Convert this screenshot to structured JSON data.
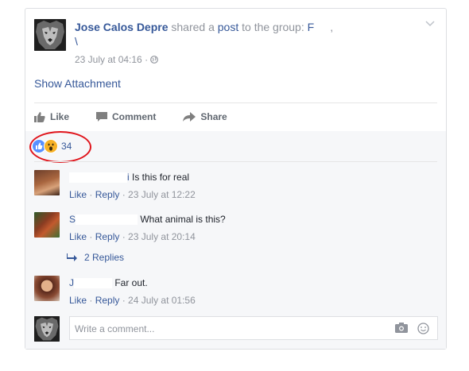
{
  "post": {
    "author": "Jose Calos Depre",
    "shared_text": " shared a ",
    "post_word": "post",
    "to_group_text": " to the group: ",
    "group_name_partial": "F",
    "group_name_second_line": "\\",
    "date": "23 July at 04:16",
    "meta_separator": "·",
    "privacy_icon": "globe-icon",
    "attachment_label": "Show Attachment"
  },
  "actions": {
    "like_label": "Like",
    "comment_label": "Comment",
    "share_label": "Share"
  },
  "reactions": {
    "icons": [
      "like-reaction-icon",
      "wow-reaction-icon"
    ],
    "count": "34",
    "highlight_color": "#e0141b"
  },
  "comments": [
    {
      "name_visible_tail": "i",
      "text": "Is this for real",
      "like": "Like",
      "reply": "Reply",
      "date": "23 July at 12:22"
    },
    {
      "name_visible_tail": "S",
      "text": "What animal is this?",
      "like": "Like",
      "reply": "Reply",
      "date": "23 July at 20:14"
    },
    {
      "name_visible_tail": "J",
      "text": "Far out.",
      "like": "Like",
      "reply": "Reply",
      "date": "24 July at 01:56"
    }
  ],
  "replies_label": "2 Replies",
  "composer": {
    "placeholder": "Write a comment...",
    "icons": [
      "camera-icon",
      "emoji-icon"
    ]
  },
  "colors": {
    "link": "#365899",
    "muted": "#90949c",
    "like_blue": "#5890ff",
    "wow_yellow": "#f7b125"
  }
}
